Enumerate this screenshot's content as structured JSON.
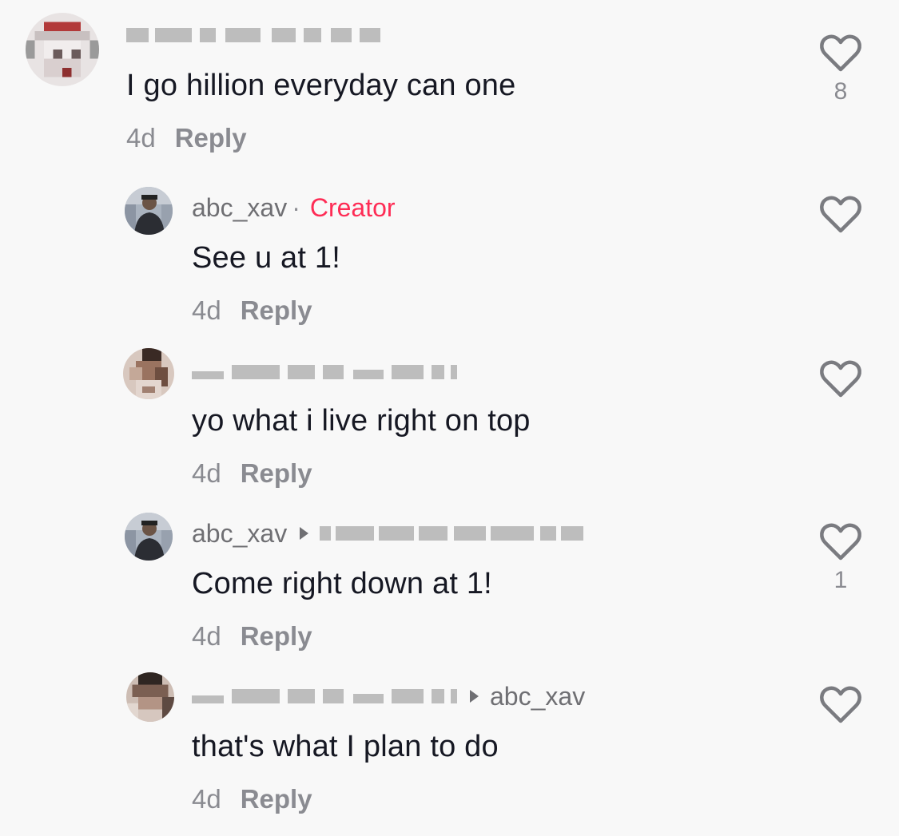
{
  "comments": [
    {
      "username": "",
      "username_obscured": true,
      "text": "I go hillion everyday can one",
      "time": "4d",
      "reply_label": "Reply",
      "likes": "8"
    },
    {
      "username": "abc_xav",
      "separator": "·",
      "badge": "Creator",
      "text": "See u at 1!",
      "time": "4d",
      "reply_label": "Reply",
      "likes": ""
    },
    {
      "username": "",
      "username_obscured": true,
      "text": "yo what i live right on top",
      "time": "4d",
      "reply_label": "Reply",
      "likes": ""
    },
    {
      "username": "abc_xav",
      "reply_to_obscured": true,
      "text": "Come right down at 1!",
      "time": "4d",
      "reply_label": "Reply",
      "likes": "1"
    },
    {
      "username": "",
      "username_obscured": true,
      "reply_to": "abc_xav",
      "text": "that's what I plan to do",
      "time": "4d",
      "reply_label": "Reply",
      "likes": ""
    }
  ],
  "colors": {
    "background": "#f8f8f8",
    "creator_badge": "#fe2c55",
    "secondary_text": "#8a8b91",
    "primary_text": "#161823"
  },
  "icons": {
    "like": "heart-outline-icon",
    "reply_arrow": "triangle-right-icon"
  }
}
